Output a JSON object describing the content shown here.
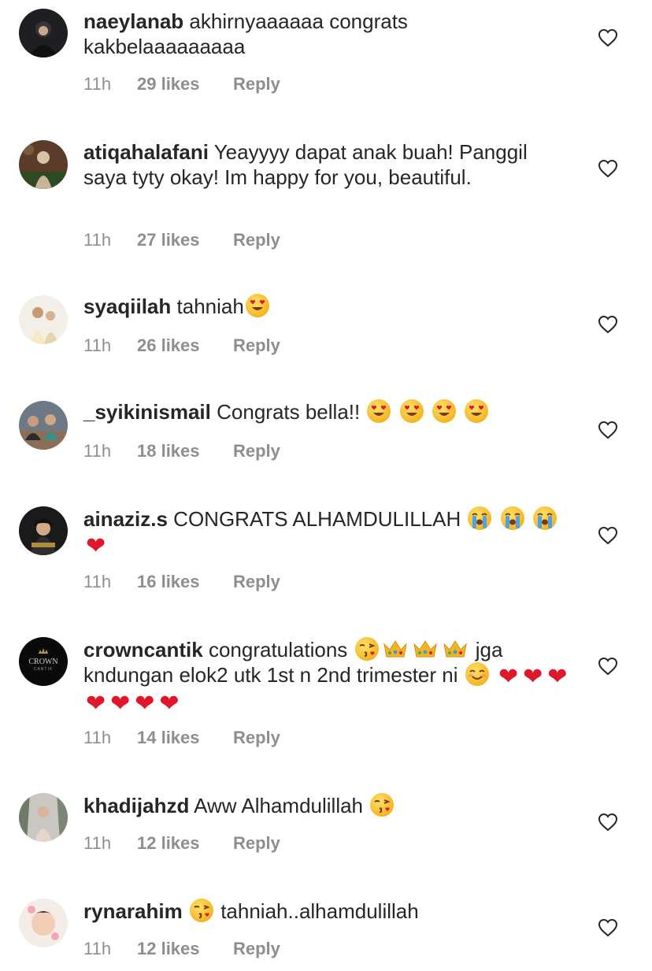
{
  "comments": [
    {
      "username": "naeylanab",
      "text": "akhirnyaaaaaa congrats kakbelaaaaaaaaa",
      "time": "11h",
      "likes": "29 likes",
      "reply": "Reply"
    },
    {
      "username": "atiqahalafani",
      "text": "Yeayyyy dapat anak buah! Panggil saya tyty okay! Im happy for you, beautiful.",
      "time": "11h",
      "likes": "27 likes",
      "reply": "Reply"
    },
    {
      "username": "syaqiilah",
      "text": "tahniah",
      "time": "11h",
      "likes": "26 likes",
      "reply": "Reply"
    },
    {
      "username": "_syikinismail",
      "text": "Congrats bella!!",
      "time": "11h",
      "likes": "18 likes",
      "reply": "Reply"
    },
    {
      "username": "ainaziz.s",
      "text": "CONGRATS ALHAMDULILLAH",
      "time": "11h",
      "likes": "16 likes",
      "reply": "Reply"
    },
    {
      "username": "crowncantik",
      "text_a": "congratulations",
      "text_b": "jga kndungan elok2 utk 1st n 2nd trimester ni",
      "avatar_text": "CROWN",
      "avatar_subtext": "CANTIK",
      "time": "11h",
      "likes": "14 likes",
      "reply": "Reply"
    },
    {
      "username": "khadijahzd",
      "text": "Aww Alhamdulillah",
      "time": "11h",
      "likes": "12 likes",
      "reply": "Reply"
    },
    {
      "username": "rynarahim",
      "text": "tahniah..alhamdulillah",
      "time": "11h",
      "likes": "12 likes",
      "reply": "Reply"
    }
  ],
  "colors": {
    "text": "#262626",
    "meta": "#8e8e8e",
    "heart": "#e0162b",
    "emoji": "#f5b521"
  },
  "icons": {
    "like": "heart-outline-icon",
    "heart_eyes": "heart-eyes-emoji",
    "crying": "loudly-crying-emoji",
    "kiss": "face-blowing-kiss-emoji",
    "smile": "smiling-face-emoji",
    "crown": "crown-emoji",
    "red_heart": "red-heart-emoji"
  }
}
